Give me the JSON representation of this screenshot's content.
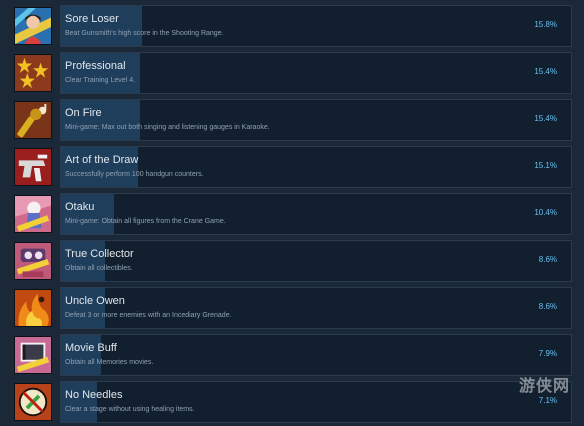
{
  "achievements": [
    {
      "title": "Sore Loser",
      "description": "Beat Gunsmith's high score in the Shooting Range.",
      "percent_label": "15.8%",
      "percent": 15.8,
      "icon": "woman-portrait-icon",
      "icon_bg": "#2a6fb0"
    },
    {
      "title": "Professional",
      "description": "Clear Training Level 4.",
      "percent_label": "15.4%",
      "percent": 15.4,
      "icon": "stars-icon",
      "icon_bg": "#8b3a1e"
    },
    {
      "title": "On Fire",
      "description": "Mini-game: Max out both singing and listening gauges in Karaoke.",
      "percent_label": "15.4%",
      "percent": 15.4,
      "icon": "microphone-icon",
      "icon_bg": "#7a3418"
    },
    {
      "title": "Art of the Draw",
      "description": "Successfully perform 100 handgun counters.",
      "percent_label": "15.1%",
      "percent": 15.1,
      "icon": "handgun-icon",
      "icon_bg": "#9a1e1e"
    },
    {
      "title": "Otaku",
      "description": "Mini-game: Obtain all figures from the Crane Game.",
      "percent_label": "10.4%",
      "percent": 10.4,
      "icon": "figure-icon",
      "icon_bg": "#d06a8a"
    },
    {
      "title": "True Collector",
      "description": "Obtain all collectibles.",
      "percent_label": "8.6%",
      "percent": 8.6,
      "icon": "collector-icon",
      "icon_bg": "#c05a7a"
    },
    {
      "title": "Uncle Owen",
      "description": "Defeat 3 or more enemies with an Incediary Grenade.",
      "percent_label": "8.6%",
      "percent": 8.6,
      "icon": "fire-icon",
      "icon_bg": "#c04a10"
    },
    {
      "title": "Movie Buff",
      "description": "Obtain all Memories movies.",
      "percent_label": "7.9%",
      "percent": 7.9,
      "icon": "film-icon",
      "icon_bg": "#c86a94"
    },
    {
      "title": "No Needles",
      "description": "Clear a stage without using healing items.",
      "percent_label": "7.1%",
      "percent": 7.1,
      "icon": "no-syringe-icon",
      "icon_bg": "#b8421a"
    }
  ],
  "watermark": "游侠网"
}
